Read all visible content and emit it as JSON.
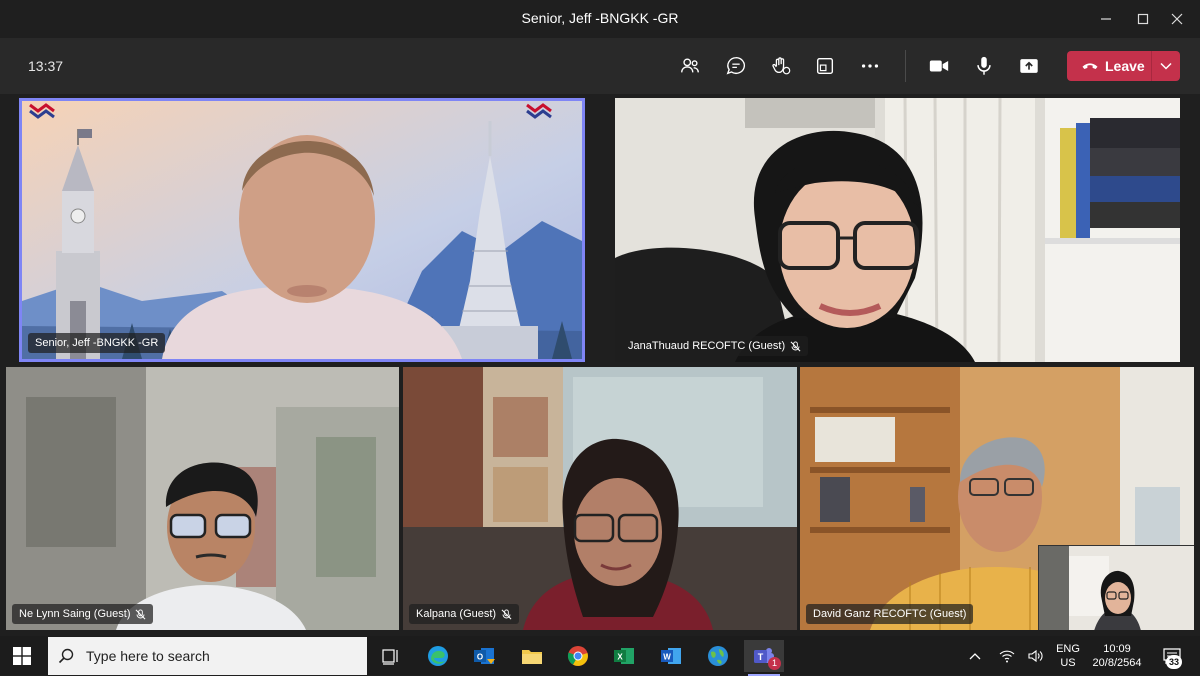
{
  "window": {
    "title": "Senior, Jeff -BNGKK -GR"
  },
  "toolbar": {
    "time": "13:37",
    "leave_label": "Leave"
  },
  "participants": [
    {
      "name": "Senior, Jeff -BNGKK -GR",
      "muted": false,
      "active_speaker": true
    },
    {
      "name": "JanaThuaud RECOFTC (Guest)",
      "muted": true
    },
    {
      "name": "Ne Lynn Saing (Guest)",
      "muted": true
    },
    {
      "name": "Kalpana (Guest)",
      "muted": true
    },
    {
      "name": "David Ganz RECOFTC (Guest)",
      "muted": false
    }
  ],
  "taskbar": {
    "search_placeholder": "Type here to search",
    "language": "ENG",
    "region": "US",
    "time": "10:09",
    "date": "20/8/2564",
    "notifications": "33",
    "teams_badge": "1"
  },
  "colors": {
    "leave": "#c4314b",
    "active_speaker": "#7f85f5",
    "toolbar": "#292929",
    "taskbar": "#1c1c1c"
  }
}
